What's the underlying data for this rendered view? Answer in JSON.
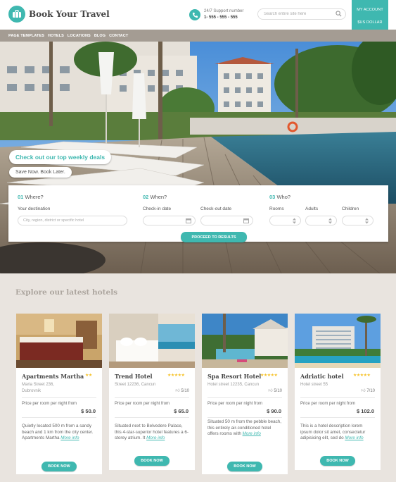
{
  "brand": {
    "name": "Book Your Travel",
    "accent": "#3fb8b0"
  },
  "support": {
    "label": "24/7 Support number",
    "phone": "1- 555 - 555 - 555"
  },
  "search": {
    "placeholder": "Search entire site here"
  },
  "account": {
    "my_account": "MY ACCOUNT",
    "currency": "$US DOLLAR"
  },
  "nav": {
    "items": [
      "PAGE TEMPLATES",
      "HOTELS",
      "LOCATIONS",
      "BLOG",
      "CONTACT"
    ]
  },
  "hero": {
    "deal": "Check out our top weekly deals",
    "save": "Save Now. Book Later."
  },
  "booking": {
    "where": {
      "num": "01",
      "title": "Where?",
      "label": "Your destination",
      "placeholder": "City, region, district or specific hotel"
    },
    "when": {
      "num": "02",
      "title": "When?",
      "checkin": "Check-in date",
      "checkout": "Check-out date"
    },
    "who": {
      "num": "03",
      "title": "Who?",
      "rooms": "Rooms",
      "adults": "Adults",
      "children": "Children"
    },
    "proceed": "PROCEED TO RESULTS"
  },
  "explore": {
    "title": "Explore our latest hotels"
  },
  "hotels": [
    {
      "name": "Apartments Martha",
      "stars": 2,
      "address": [
        "Maria Street 236,",
        "Dubrovnik"
      ],
      "rating": "",
      "price_label": "Price per room per night from",
      "price": "$ 50.0",
      "desc": "Quietly located 500 m from a sandy beach and 1 km from the city center.  Apartments Martha",
      "more": "More info",
      "button": "BOOK NOW"
    },
    {
      "name": "Trend Hotel",
      "stars": 5,
      "address": [
        "Street 12236, Cancun"
      ],
      "rating": "5/10",
      "price_label": "Price per room per night from",
      "price": "$ 65.0",
      "desc": "Situated next to Belvedere Palace, this 4-star-superior hotel features a 6-storey atrium. It",
      "more": "More info",
      "button": "BOOK NOW"
    },
    {
      "name": "Spa Resort Hotel",
      "stars": 5,
      "address": [
        "Hotel street 12235, Cancun"
      ],
      "rating": "5/10",
      "price_label": "Price per room per night from",
      "price": "$ 90.0",
      "desc": "Situated 50 m from the pebble beach, this entirely air-conditioned hotel offers rooms with",
      "more": "More info",
      "button": "BOOK NOW"
    },
    {
      "name": "Adriatic hotel",
      "stars": 5,
      "address": [
        "Hotel street 55"
      ],
      "rating": "7/10",
      "price_label": "Price per room per night from",
      "price": "$ 102.0",
      "desc": "This is a hotel description lorem ipsum dolor sit amet, consectetur adipisicing elit, sed do",
      "more": "More info",
      "button": "BOOK NOW"
    }
  ]
}
